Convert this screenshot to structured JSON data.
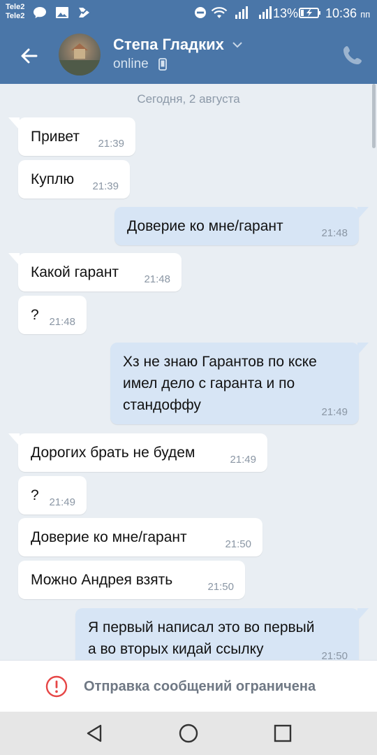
{
  "status_bar": {
    "carrier_1": "Tele2",
    "carrier_2": "Tele2",
    "battery": "13%",
    "time": "10:36",
    "time_suffix": "пп",
    "icons": [
      "chat-notification-icon",
      "image-icon",
      "check-icon",
      "dnd-icon",
      "wifi-icon",
      "signal-icon",
      "signal-icon",
      "battery-charging-icon"
    ]
  },
  "header": {
    "back_icon": "arrow-left-icon",
    "contact_name": "Степа Гладких",
    "status": "online",
    "status_icon": "mobile-icon",
    "call_icon": "phone-icon"
  },
  "chat": {
    "date_separator": "Сегодня, 2 августа",
    "messages": [
      {
        "direction": "in",
        "text": "Привет",
        "time": "21:39"
      },
      {
        "direction": "in",
        "text": "Куплю",
        "time": "21:39"
      },
      {
        "direction": "out",
        "text": "Доверие ко мне/гарант",
        "time": "21:48"
      },
      {
        "direction": "in",
        "text": "Какой гарант",
        "time": "21:48"
      },
      {
        "direction": "in",
        "text": "?",
        "time": "21:48"
      },
      {
        "direction": "out",
        "text": "Хз не знаю Гарантов по кске\nимел дело с гаранта и по\nстандоффу",
        "time": "21:49"
      },
      {
        "direction": "in",
        "text": "Дорогих брать не будем",
        "time": "21:49"
      },
      {
        "direction": "in",
        "text": "?",
        "time": "21:49"
      },
      {
        "direction": "in",
        "text": "Доверие ко мне/гарант",
        "time": "21:50"
      },
      {
        "direction": "in",
        "text": "Можно Андрея взять",
        "time": "21:50"
      },
      {
        "direction": "out",
        "text": "Я первый написал это во первый\nа во вторых кидай ссылку",
        "time": "21:50"
      }
    ]
  },
  "restriction": {
    "icon": "alert-circle-icon",
    "text": "Отправка сообщений ограничена"
  },
  "colors": {
    "brand": "#4a76a8",
    "incoming_bubble": "#ffffff",
    "outgoing_bubble": "#d7e5f5",
    "chat_background": "#e9eef3",
    "alert": "#e64646"
  },
  "nav_bar": {
    "buttons": [
      "back-triangle-icon",
      "home-circle-icon",
      "recents-square-icon"
    ]
  }
}
